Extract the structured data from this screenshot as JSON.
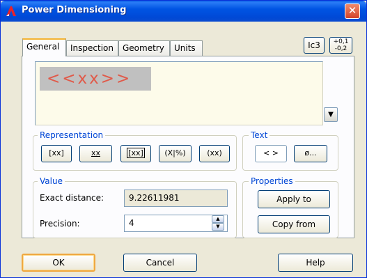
{
  "window": {
    "title": "Power Dimensioning",
    "close_glyph": "✕"
  },
  "header_buttons": {
    "icon_button_label": "Ic3",
    "tolerance_top": "+0,1",
    "tolerance_bottom": "-0,2"
  },
  "tabs": [
    {
      "label": "General",
      "active": true
    },
    {
      "label": "Inspection",
      "active": false
    },
    {
      "label": "Geometry",
      "active": false
    },
    {
      "label": "Units",
      "active": false
    }
  ],
  "preview": {
    "text": "<<xx>>",
    "text_color": "#e05a4a"
  },
  "representation": {
    "title": "Representation",
    "buttons": [
      "[xx]",
      "xx",
      "[xx]",
      "(X|%)",
      "(xx)"
    ]
  },
  "text_group": {
    "title": "Text",
    "buttons": [
      "< >",
      "ø..."
    ]
  },
  "value": {
    "title": "Value",
    "exact_distance_label": "Exact distance:",
    "exact_distance_value": "9.22611981",
    "precision_label": "Precision:",
    "precision_value": "4"
  },
  "properties": {
    "title": "Properties",
    "apply_to": "Apply to",
    "copy_from": "Copy from"
  },
  "footer": {
    "ok": "OK",
    "cancel": "Cancel",
    "help": "Help"
  },
  "colors": {
    "titlebar": "#0054e3",
    "group_title": "#0046d5",
    "default_button_border": "#f0a840"
  },
  "icons": {
    "app": "autocad-icon",
    "close": "close-icon",
    "dropdown": "chevron-down-icon",
    "spin_up": "spin-up-icon",
    "spin_down": "spin-down-icon"
  }
}
